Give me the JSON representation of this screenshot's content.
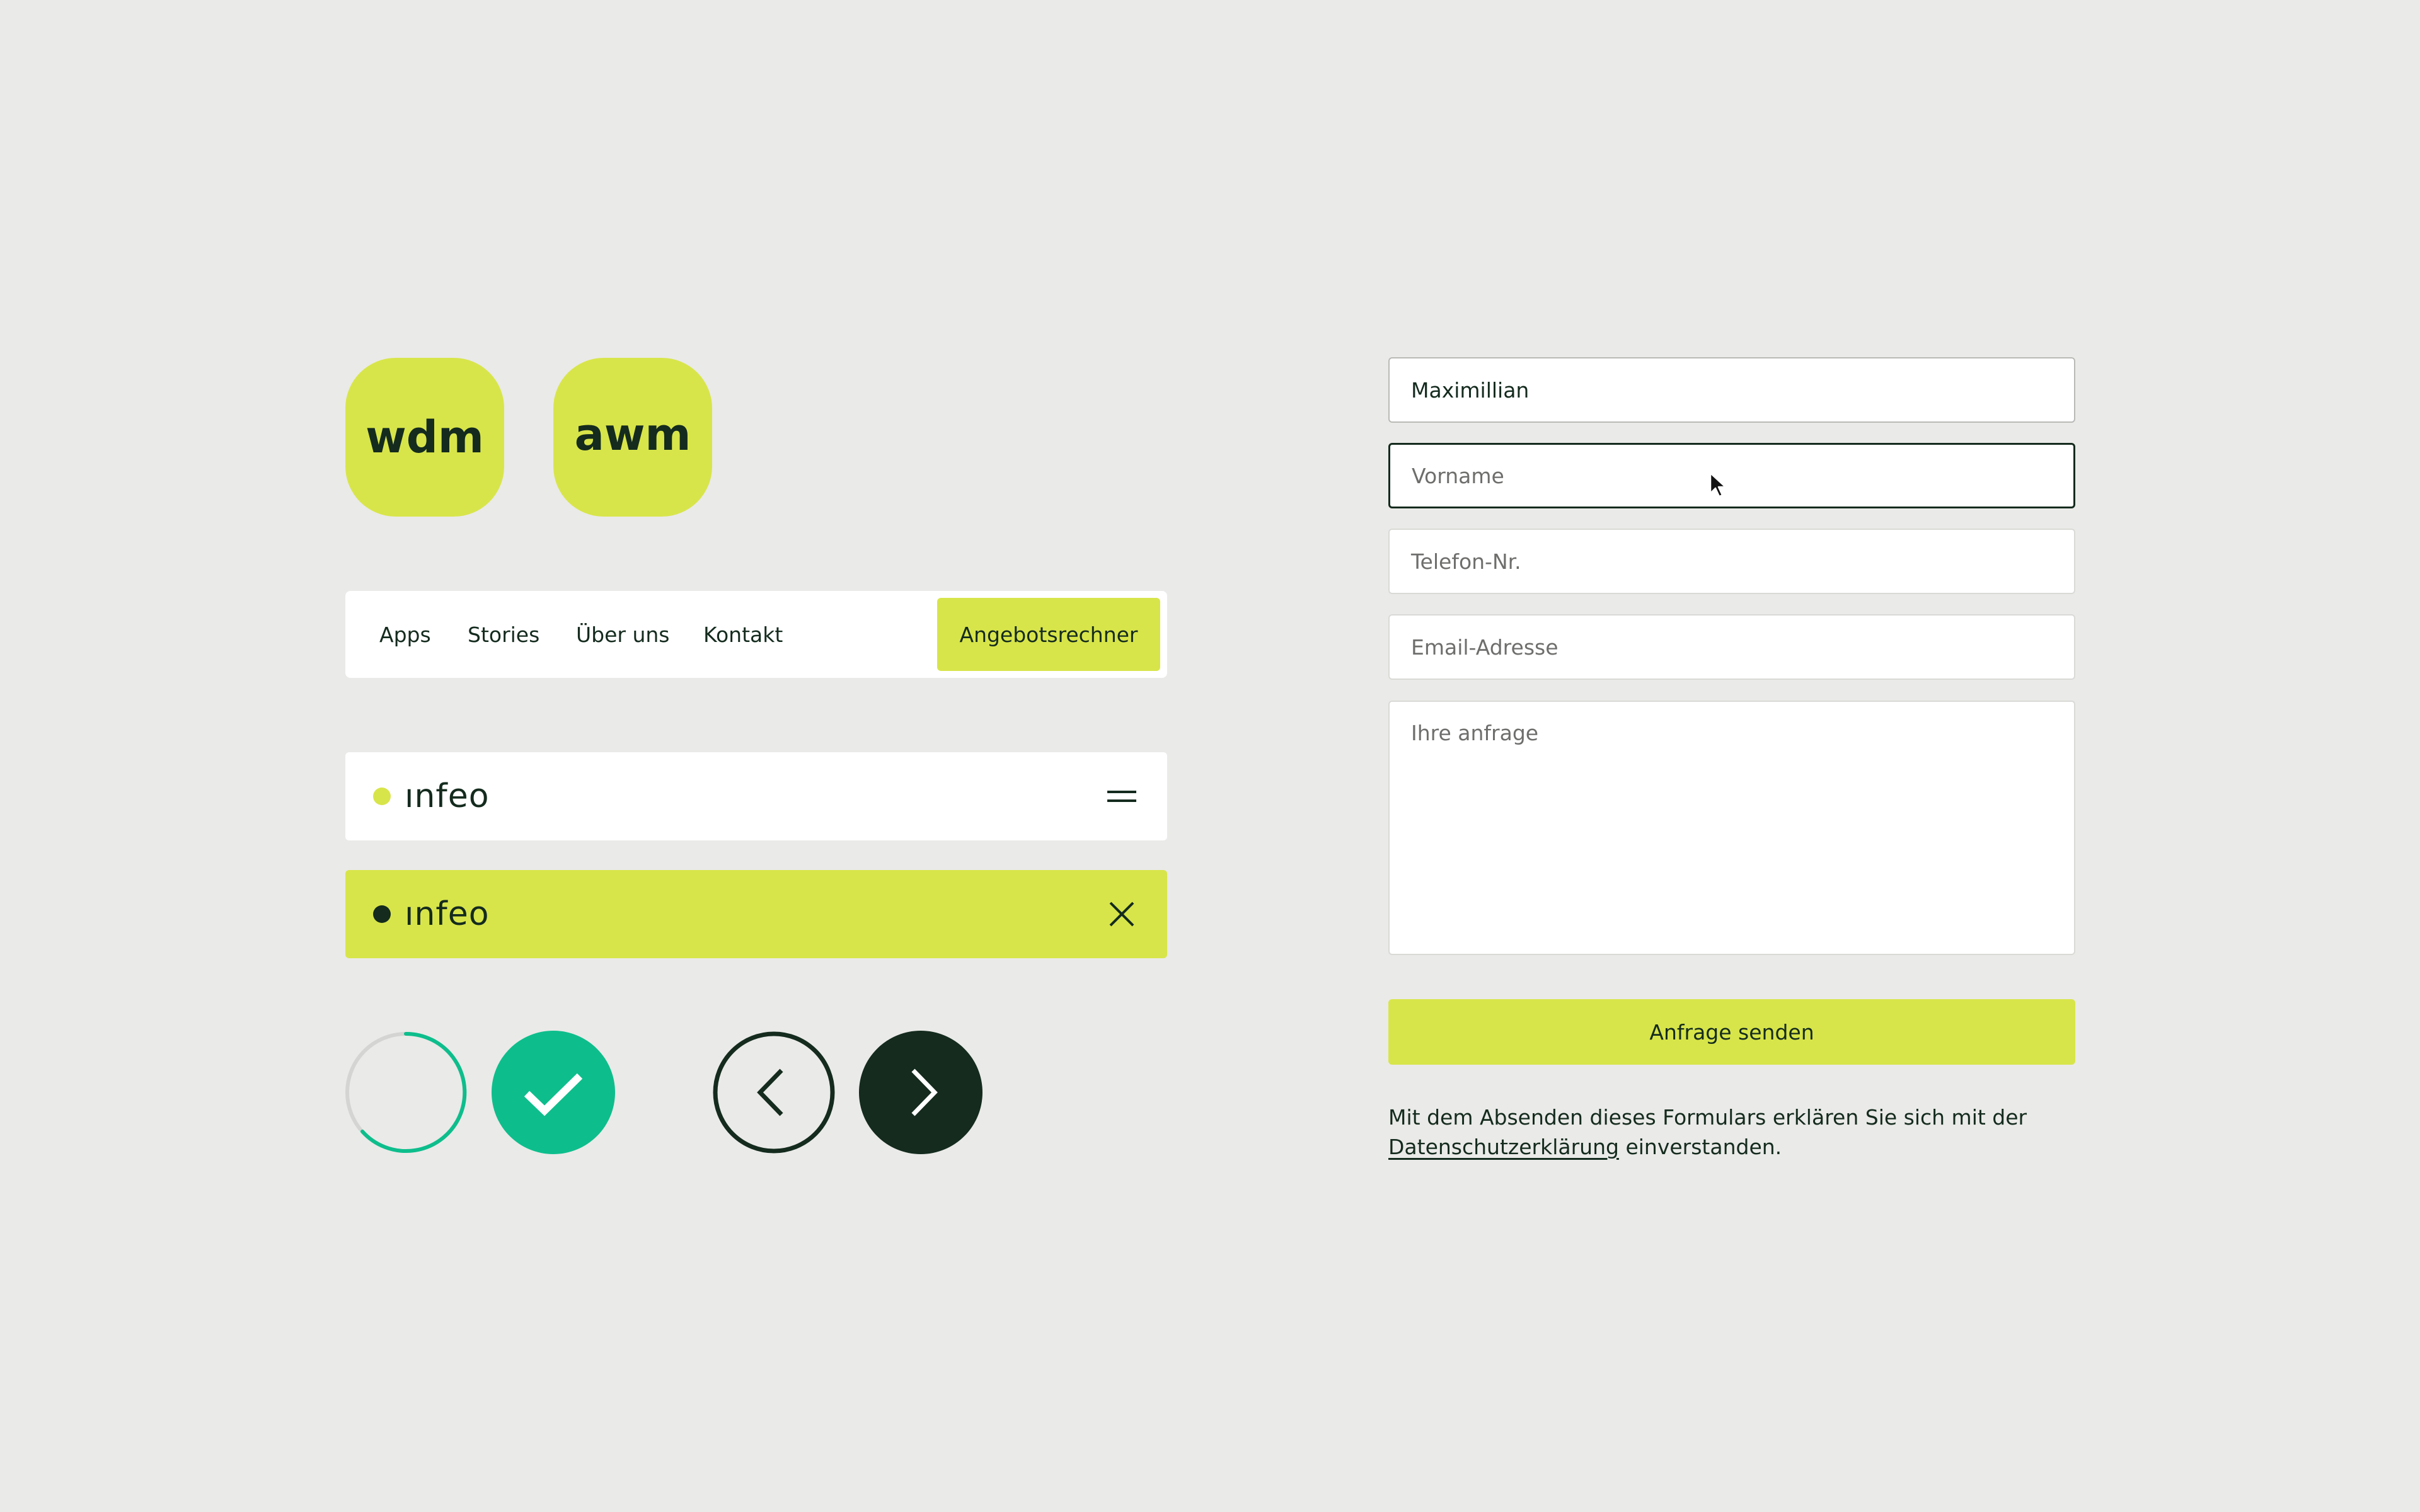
{
  "app_icons": {
    "wdm": "wdm",
    "awm": "awm",
    "color": "#d8e54a"
  },
  "nav": {
    "items": [
      "Apps",
      "Stories",
      "Über uns",
      "Kontakt"
    ],
    "cta_label": "Angebotsrechner"
  },
  "header_closed": {
    "logo_text": "ınfeo",
    "menu_icon": "hamburger-icon"
  },
  "header_open": {
    "logo_text": "ınfeo",
    "close_icon": "close-icon"
  },
  "controls": {
    "spinner_icon": "loading-spinner",
    "success_icon": "check-icon",
    "prev_icon": "chevron-left-icon",
    "next_icon": "chevron-right-icon"
  },
  "form": {
    "name_value": "Maximillian",
    "vorname_placeholder": "Vorname",
    "phone_placeholder": "Telefon-Nr.",
    "email_placeholder": "Email-Adresse",
    "message_placeholder": "Ihre anfrage",
    "submit_label": "Anfrage senden",
    "consent_prefix": "Mit dem Absenden dieses Formulars erklären Sie sich mit der",
    "consent_link": "Datenschutzerklärung",
    "consent_suffix": "einverstanden."
  },
  "colors": {
    "accent": "#d8e54a",
    "dark": "#142b1e",
    "success": "#0dbe8c",
    "background": "#eaeae8"
  }
}
